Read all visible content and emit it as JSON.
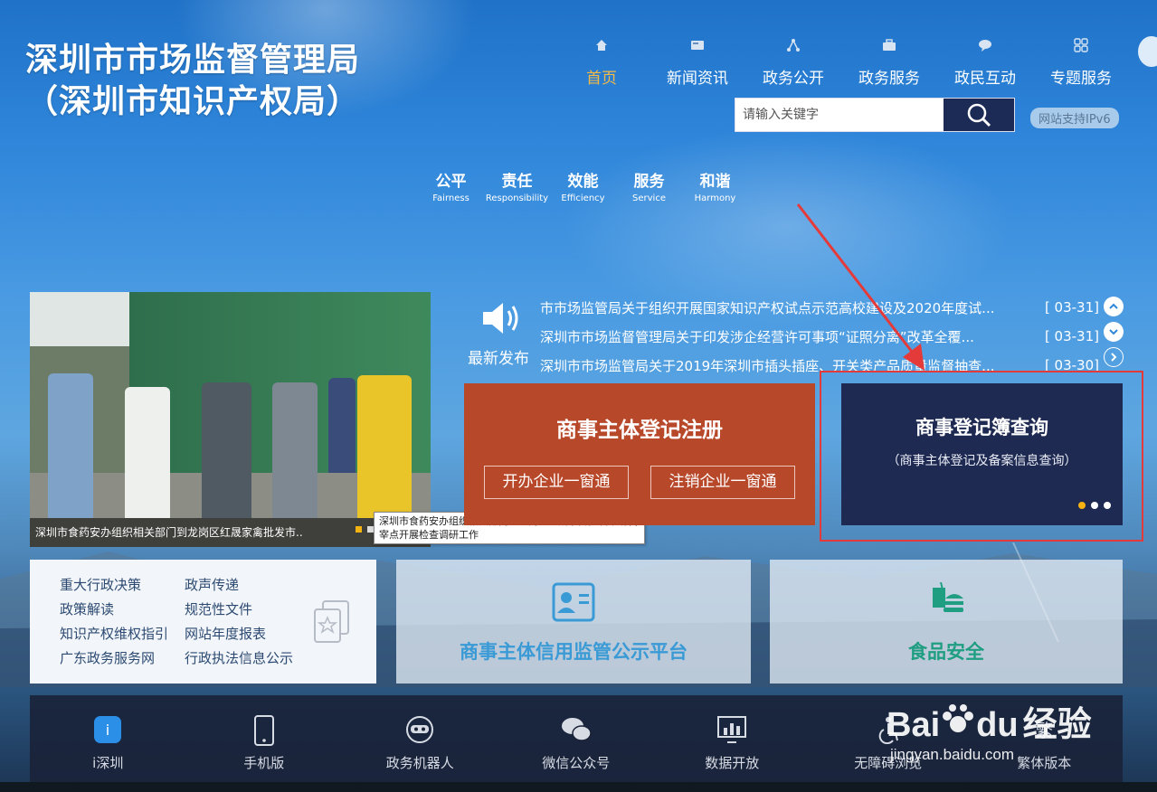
{
  "site": {
    "title_line1": "深圳市市场监督管理局",
    "title_line2": "（深圳市知识产权局）"
  },
  "nav": [
    {
      "label": "首页",
      "icon": "home-icon",
      "active": true
    },
    {
      "label": "新闻资讯",
      "icon": "news-icon"
    },
    {
      "label": "政务公开",
      "icon": "network-icon"
    },
    {
      "label": "政务服务",
      "icon": "briefcase-icon"
    },
    {
      "label": "政民互动",
      "icon": "chat-icon"
    },
    {
      "label": "专题服务",
      "icon": "grid-icon"
    }
  ],
  "search": {
    "placeholder": "请输入关键字"
  },
  "ipv6": "网站支持IPv6",
  "values": [
    {
      "zh": "公平",
      "en": "Fairness"
    },
    {
      "zh": "责任",
      "en": "Responsibility"
    },
    {
      "zh": "效能",
      "en": "Efficiency"
    },
    {
      "zh": "服务",
      "en": "Service"
    },
    {
      "zh": "和谐",
      "en": "Harmony"
    }
  ],
  "photo": {
    "caption": "深圳市食药安办组织相关部门到龙岗区红晟家禽批发市..",
    "tooltip": "深圳市食药安办组织相关部门到龙岗区红晟家禽批发市场代宰点开展检查调研工作"
  },
  "news": {
    "label": "最新发布",
    "items": [
      {
        "title": "市市场监管局关于组织开展国家知识产权试点示范高校建设及2020年度试...",
        "date": "[ 03-31]"
      },
      {
        "title": "深圳市市场监督管理局关于印发涉企经营许可事项“证照分离”改革全覆...",
        "date": "[ 03-31]"
      },
      {
        "title": "深圳市市场监管局关于2019年深圳市插头插座、开关类产品质量监督抽查...",
        "date": "[ 03-30]"
      }
    ]
  },
  "registration": {
    "title": "商事主体登记注册",
    "open_btn": "开办企业一窗通",
    "cancel_btn": "注销企业一窗通"
  },
  "registry_query": {
    "title": "商事登记簿查询",
    "subtitle": "（商事主体登记及备案信息查询）"
  },
  "links": [
    "重大行政决策",
    "政声传递",
    "政策解读",
    "规范性文件",
    "知识产权维权指引",
    "网站年度报表",
    "广东政务服务网",
    "行政执法信息公示"
  ],
  "credit_platform": "商事主体信用监管公示平台",
  "food_safety": "食品安全",
  "bottom": [
    {
      "label": "i深圳",
      "icon": "ishenzhen-icon"
    },
    {
      "label": "手机版",
      "icon": "phone-icon"
    },
    {
      "label": "政务机器人",
      "icon": "robot-icon"
    },
    {
      "label": "微信公众号",
      "icon": "wechat-icon"
    },
    {
      "label": "数据开放",
      "icon": "data-chart-icon"
    },
    {
      "label": "无障碍浏览",
      "icon": "accessibility-icon"
    },
    {
      "label": "繁体版本",
      "icon": "traditional-icon"
    }
  ],
  "watermark": {
    "brand": "Bai",
    "brand2": "du",
    "product": "经验",
    "url": "jingyan.baidu.com"
  },
  "colors": {
    "accent": "#f5b945",
    "registration_bg": "#b8482a",
    "query_bg": "#1e2a52",
    "highlight": "#e43a3a"
  }
}
